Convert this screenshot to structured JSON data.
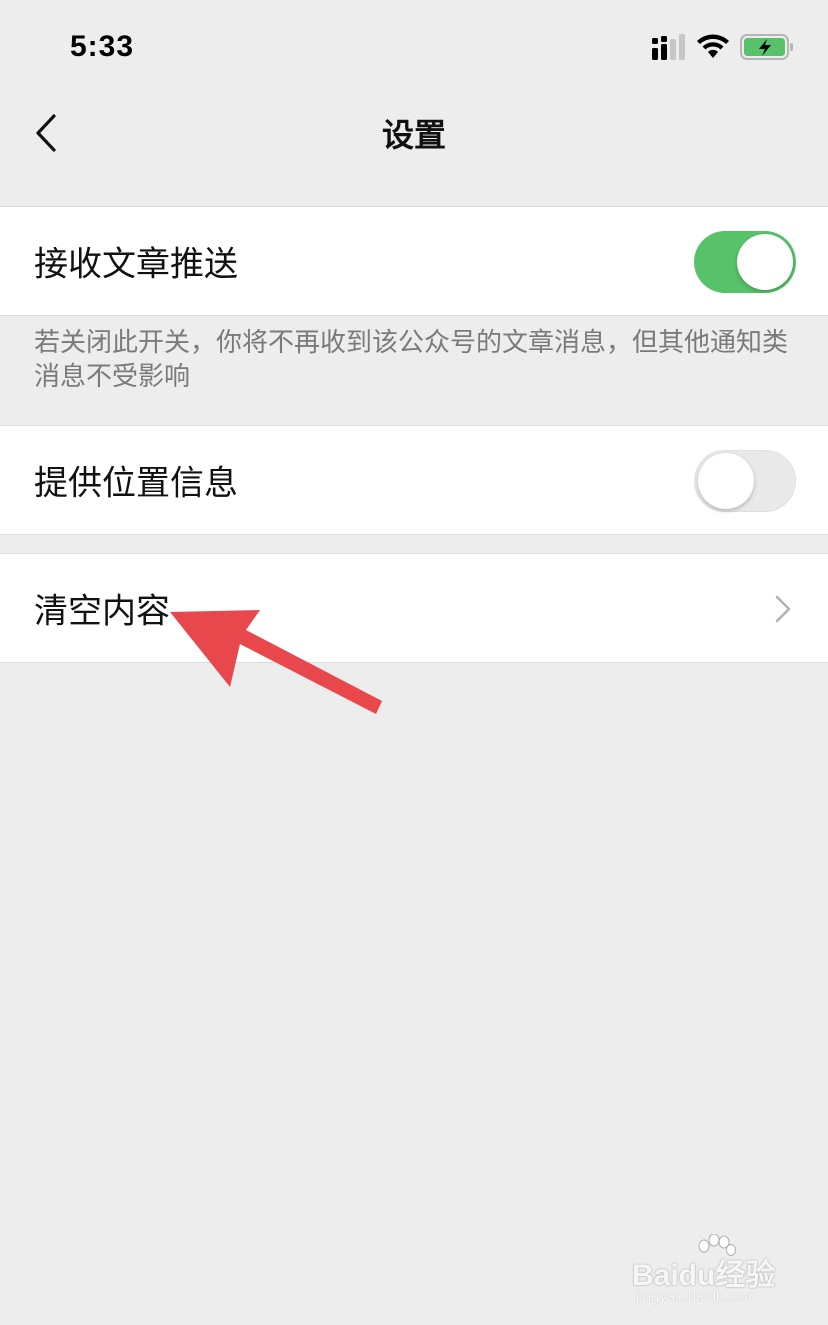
{
  "status_bar": {
    "time": "5:33"
  },
  "nav": {
    "title": "设置",
    "back_icon": "chevron-left-icon"
  },
  "settings": {
    "receive_articles": {
      "label": "接收文章推送",
      "enabled": true,
      "note": "若关闭此开关，你将不再收到该公众号的文章消息，但其他通知类消息不受影响"
    },
    "location": {
      "label": "提供位置信息",
      "enabled": false
    },
    "clear_content": {
      "label": "清空内容"
    }
  },
  "annotation": {
    "arrow_color": "#e8474c"
  },
  "watermark": {
    "main": "Baidu经验",
    "sub": "jingyan.baidu.com"
  },
  "colors": {
    "background": "#ededed",
    "toggle_on": "#57c26a",
    "toggle_off": "#e9e9ea",
    "battery": "#57c26a"
  }
}
